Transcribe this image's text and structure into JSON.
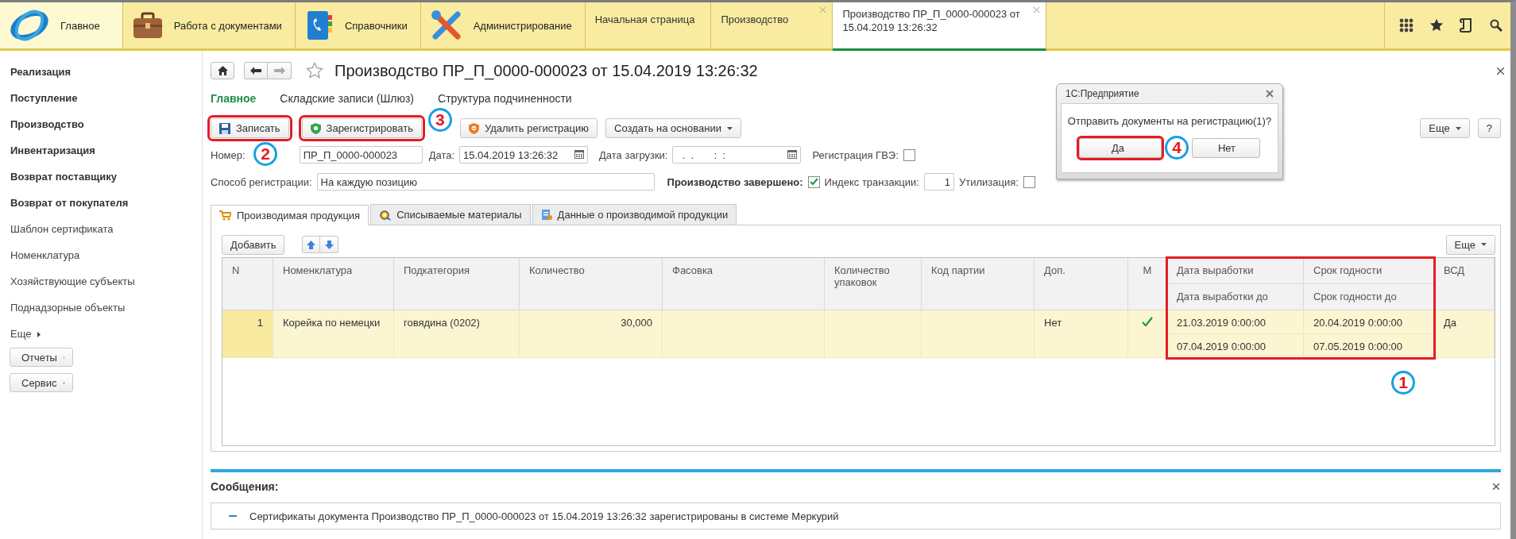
{
  "top_bar": {
    "sections": [
      {
        "label": "Главное",
        "kind": "logo",
        "selected": true
      },
      {
        "label": "Работа с документами",
        "kind": "briefcase",
        "selected": false
      },
      {
        "label": "Справочники",
        "kind": "book",
        "selected": false
      },
      {
        "label": "Администрирование",
        "kind": "tools",
        "selected": false
      }
    ],
    "tabs": [
      {
        "label": "Начальная страница",
        "selected": false,
        "closable": false
      },
      {
        "label": "Производство",
        "selected": false,
        "closable": true
      },
      {
        "label": "Производство ПР_П_0000-000023 от 15.04.2019 13:26:32",
        "selected": true,
        "closable": true
      }
    ]
  },
  "sidebar": {
    "items": [
      {
        "label": "Реализация",
        "kind": "section"
      },
      {
        "label": "Поступление",
        "kind": "section"
      },
      {
        "label": "Производство",
        "kind": "section"
      },
      {
        "label": "Инвентаризация",
        "kind": "section"
      },
      {
        "label": "Возврат поставщику",
        "kind": "section"
      },
      {
        "label": "Возврат от покупателя",
        "kind": "section"
      },
      {
        "label": "Шаблон сертификата",
        "kind": "link"
      },
      {
        "label": "Номенклатура",
        "kind": "link"
      },
      {
        "label": "Хозяйствующие субъекты",
        "kind": "link"
      },
      {
        "label": "Поднадзорные объекты",
        "kind": "link"
      },
      {
        "label": "Еще",
        "kind": "more"
      },
      {
        "label": "Отчеты",
        "kind": "button"
      },
      {
        "label": "Сервис",
        "kind": "button"
      }
    ]
  },
  "document": {
    "title": "Производство ПР_П_0000-000023 от 15.04.2019 13:26:32",
    "nav": [
      {
        "label": "Главное",
        "selected": true
      },
      {
        "label": "Складские записи (Шлюз)",
        "selected": false
      },
      {
        "label": "Структура подчиненности",
        "selected": false
      }
    ],
    "toolbar": [
      {
        "label": "Записать",
        "kind": "save",
        "highlighted": true,
        "marker": "2"
      },
      {
        "label": "Зарегистрировать",
        "kind": "register",
        "highlighted": true,
        "marker": "3"
      },
      {
        "label": "Удалить регистрацию",
        "kind": "unregister",
        "highlighted": false
      },
      {
        "label": "Создать на основании",
        "kind": "dropdown",
        "highlighted": false
      }
    ],
    "toolbar_right": [
      {
        "label": "Еще",
        "kind": "dropdown"
      },
      {
        "label": "?",
        "kind": "plain"
      }
    ],
    "number": {
      "label": "Номер:",
      "value": "ПР_П_0000-000023"
    },
    "date": {
      "label": "Дата:",
      "value": "15.04.2019 13:26:32"
    },
    "load_date": {
      "label": "Дата загрузки:",
      "value": "  .  .       :  :"
    },
    "gve": {
      "label": "Регистрация ГВЭ:",
      "checked": false
    },
    "method": {
      "label": "Способ регистрации:",
      "value": "На каждую позицию"
    },
    "completed": {
      "label": "Производство завершено:",
      "checked": true
    },
    "tx_index": {
      "label": "Индекс транзакции:",
      "value": "1"
    },
    "disposal": {
      "label": "Утилизация:",
      "checked": false
    },
    "tabs": [
      {
        "label": "Производимая продукция",
        "kind": "cart",
        "selected": true
      },
      {
        "label": "Списываемые материалы",
        "kind": "materials",
        "selected": false
      },
      {
        "label": "Данные о производимой продукции",
        "kind": "data",
        "selected": false
      }
    ],
    "table_toolbar": {
      "add": "Добавить",
      "more": "Еще"
    },
    "table": {
      "columns": [
        {
          "label": "N",
          "kind": "number"
        },
        {
          "label": "Номенклатура",
          "kind": "text"
        },
        {
          "label": "Подкатегория",
          "kind": "text"
        },
        {
          "label": "Количество",
          "kind": "number"
        },
        {
          "label": "Фасовка",
          "kind": "text"
        },
        {
          "label": "Количество упаковок",
          "kind": "text"
        },
        {
          "label": "Код партии",
          "kind": "text"
        },
        {
          "label": "Доп.",
          "kind": "text"
        },
        {
          "label": "М",
          "kind": "check"
        },
        {
          "label": "Дата выработки",
          "sublabel": "Дата выработки до",
          "kind": "dates",
          "highlighted": true
        },
        {
          "label": "Срок годности",
          "sublabel": "Срок годности до",
          "kind": "dates",
          "highlighted": true
        },
        {
          "label": "ВСД",
          "kind": "text"
        }
      ],
      "rows": [
        {
          "selected": true,
          "cells": [
            "1",
            "Корейка по немецки",
            "говядина (0202)",
            "30,000",
            null,
            null,
            null,
            "Нет",
            true,
            [
              "21.03.2019 0:00:00",
              "07.04.2019 0:00:00"
            ],
            [
              "20.04.2019 0:00:00",
              "07.05.2019 0:00:00"
            ],
            "Да"
          ]
        }
      ],
      "marker": "1"
    }
  },
  "messages": {
    "title": "Сообщения:",
    "items": [
      "Сертификаты документа Производство ПР_П_0000-000023 от 15.04.2019 13:26:32 зарегистрированы в системе Меркурий"
    ]
  },
  "dialog": {
    "title": "1С:Предприятие",
    "message": "Отправить документы на регистрацию(1)?",
    "buttons": [
      {
        "label": "Да",
        "highlighted": true,
        "marker": "4"
      },
      {
        "label": "Нет",
        "highlighted": false
      }
    ]
  }
}
